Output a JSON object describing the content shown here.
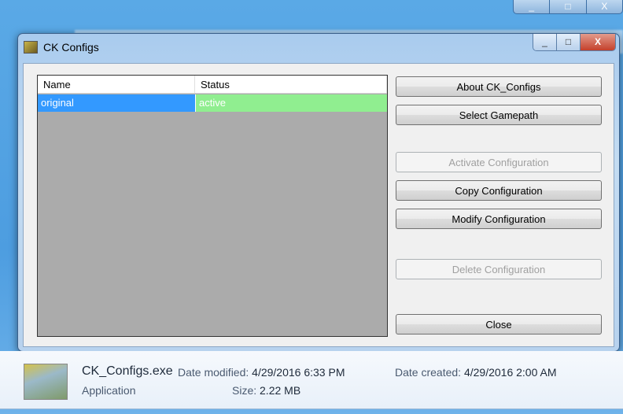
{
  "window": {
    "title": "CK Configs",
    "minimize": "_",
    "maximize": "□",
    "close": "X"
  },
  "list": {
    "columns": [
      "Name",
      "Status"
    ],
    "rows": [
      {
        "name": "original",
        "status": "active"
      }
    ]
  },
  "buttons": {
    "about": "About CK_Configs",
    "gamepath": "Select Gamepath",
    "activate": "Activate Configuration",
    "copy": "Copy Configuration",
    "modify": "Modify Configuration",
    "delete": "Delete Configuration",
    "close": "Close"
  },
  "details": {
    "filename": "CK_Configs.exe",
    "type": "Application",
    "modified_label": "Date modified:",
    "modified": "4/29/2016 6:33 PM",
    "created_label": "Date created:",
    "created": "4/29/2016 2:00 AM",
    "size_label": "Size:",
    "size": "2.22 MB"
  },
  "colors": {
    "selected_name": "#3399ff",
    "active_status": "#90ee90"
  }
}
